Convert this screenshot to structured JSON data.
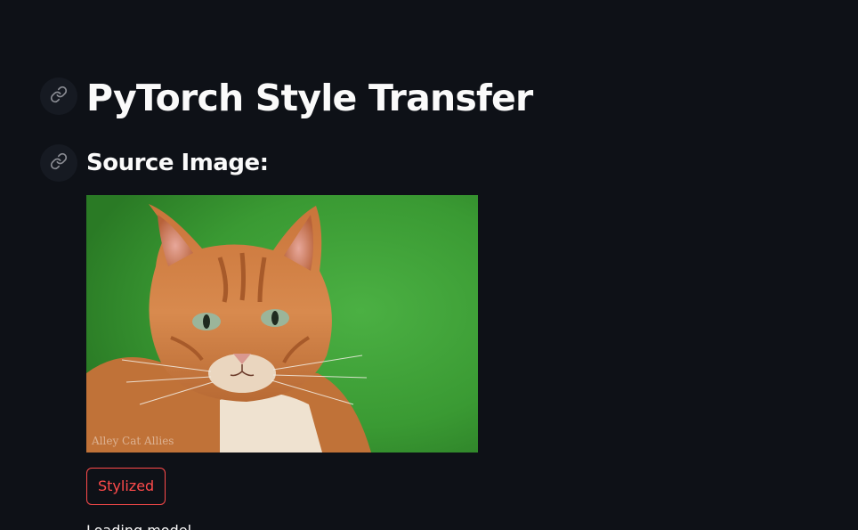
{
  "page": {
    "title": "PyTorch Style Transfer",
    "source_heading": "Source Image:"
  },
  "icons": {
    "title_anchor": "link-icon",
    "source_anchor": "link-icon"
  },
  "source_image": {
    "alt": "Orange tabby cat on green background",
    "watermark": "Alley Cat Allies"
  },
  "actions": {
    "stylized_label": "Stylized"
  },
  "status": {
    "text": "Loading model..."
  },
  "colors": {
    "background": "#0e1117",
    "text": "#fafafa",
    "accent": "#ff4b4b",
    "anchor_bg": "#161a22"
  }
}
